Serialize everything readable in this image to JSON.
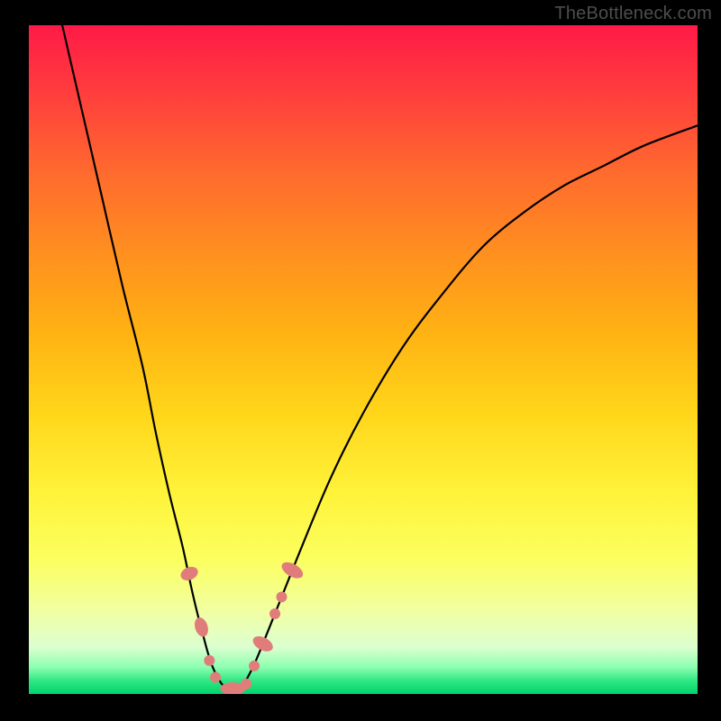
{
  "watermark": "TheBottleneck.com",
  "colors": {
    "background": "#000000",
    "curve_stroke": "#000000",
    "marker_fill": "#e07d7a",
    "marker_stroke": "#c56864"
  },
  "chart_data": {
    "type": "line",
    "title": "",
    "xlabel": "",
    "ylabel": "",
    "xlim": [
      0,
      100
    ],
    "ylim": [
      0,
      100
    ],
    "grid": false,
    "curve": [
      {
        "x": 5,
        "y": 100
      },
      {
        "x": 8,
        "y": 87
      },
      {
        "x": 11,
        "y": 74
      },
      {
        "x": 14,
        "y": 61
      },
      {
        "x": 17,
        "y": 49
      },
      {
        "x": 19,
        "y": 39
      },
      {
        "x": 21,
        "y": 30
      },
      {
        "x": 23,
        "y": 22
      },
      {
        "x": 24.5,
        "y": 15
      },
      {
        "x": 26,
        "y": 9
      },
      {
        "x": 27.5,
        "y": 4
      },
      {
        "x": 29.5,
        "y": 0.8
      },
      {
        "x": 31.5,
        "y": 0.8
      },
      {
        "x": 33.5,
        "y": 4
      },
      {
        "x": 36,
        "y": 10
      },
      {
        "x": 40,
        "y": 20
      },
      {
        "x": 45,
        "y": 32
      },
      {
        "x": 50,
        "y": 42
      },
      {
        "x": 56,
        "y": 52
      },
      {
        "x": 62,
        "y": 60
      },
      {
        "x": 68,
        "y": 67
      },
      {
        "x": 74,
        "y": 72
      },
      {
        "x": 80,
        "y": 76
      },
      {
        "x": 86,
        "y": 79
      },
      {
        "x": 92,
        "y": 82
      },
      {
        "x": 100,
        "y": 85
      }
    ],
    "markers": [
      {
        "x": 24.0,
        "y": 18,
        "rx": 7,
        "ry": 10,
        "rot": 67
      },
      {
        "x": 25.8,
        "y": 10,
        "rx": 11,
        "ry": 7,
        "rot": 72
      },
      {
        "x": 27.0,
        "y": 5,
        "rx": 6,
        "ry": 6,
        "rot": 0
      },
      {
        "x": 27.9,
        "y": 2.5,
        "rx": 6,
        "ry": 6,
        "rot": 0
      },
      {
        "x": 30.5,
        "y": 0.8,
        "rx": 14,
        "ry": 7,
        "rot": 0
      },
      {
        "x": 32.5,
        "y": 1.5,
        "rx": 6,
        "ry": 6,
        "rot": 0
      },
      {
        "x": 33.7,
        "y": 4.2,
        "rx": 6,
        "ry": 6,
        "rot": 0
      },
      {
        "x": 35.0,
        "y": 7.5,
        "rx": 7,
        "ry": 12,
        "rot": -62
      },
      {
        "x": 36.8,
        "y": 12,
        "rx": 6,
        "ry": 6,
        "rot": 0
      },
      {
        "x": 37.8,
        "y": 14.5,
        "rx": 6,
        "ry": 6,
        "rot": 0
      },
      {
        "x": 39.4,
        "y": 18.5,
        "rx": 7,
        "ry": 13,
        "rot": -60
      }
    ]
  }
}
